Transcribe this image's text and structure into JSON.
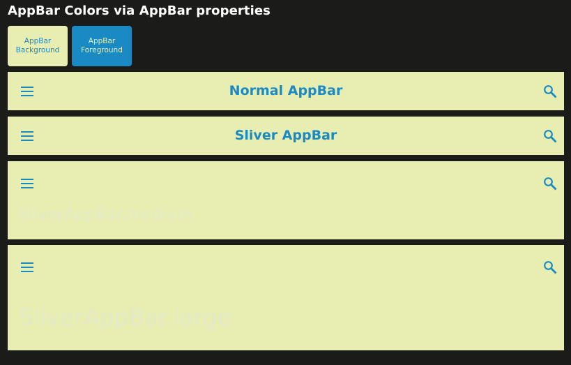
{
  "header": {
    "title": "AppBar Colors via AppBar properties"
  },
  "swatches": {
    "background": {
      "line1": "AppBar",
      "line2": "Background",
      "color": "#e8eeb1"
    },
    "foreground": {
      "line1": "AppBar",
      "line2": "Foreground",
      "color": "#1a8ac4"
    }
  },
  "appbars": {
    "normal": {
      "title": "Normal AppBar",
      "leading_icon": "menu-icon",
      "action_icon": "search-icon"
    },
    "sliver": {
      "title": "Sliver AppBar",
      "leading_icon": "menu-icon",
      "action_icon": "search-icon"
    },
    "medium": {
      "title": "SliverAppBar.medium",
      "leading_icon": "menu-icon",
      "action_icon": "search-icon"
    },
    "large": {
      "title": "SliverAppBar.large",
      "leading_icon": "menu-icon",
      "action_icon": "search-icon"
    }
  },
  "colors": {
    "page_background": "#1b1c19",
    "appbar_background": "#e8eeb1",
    "appbar_foreground": "#1a8ac4"
  }
}
